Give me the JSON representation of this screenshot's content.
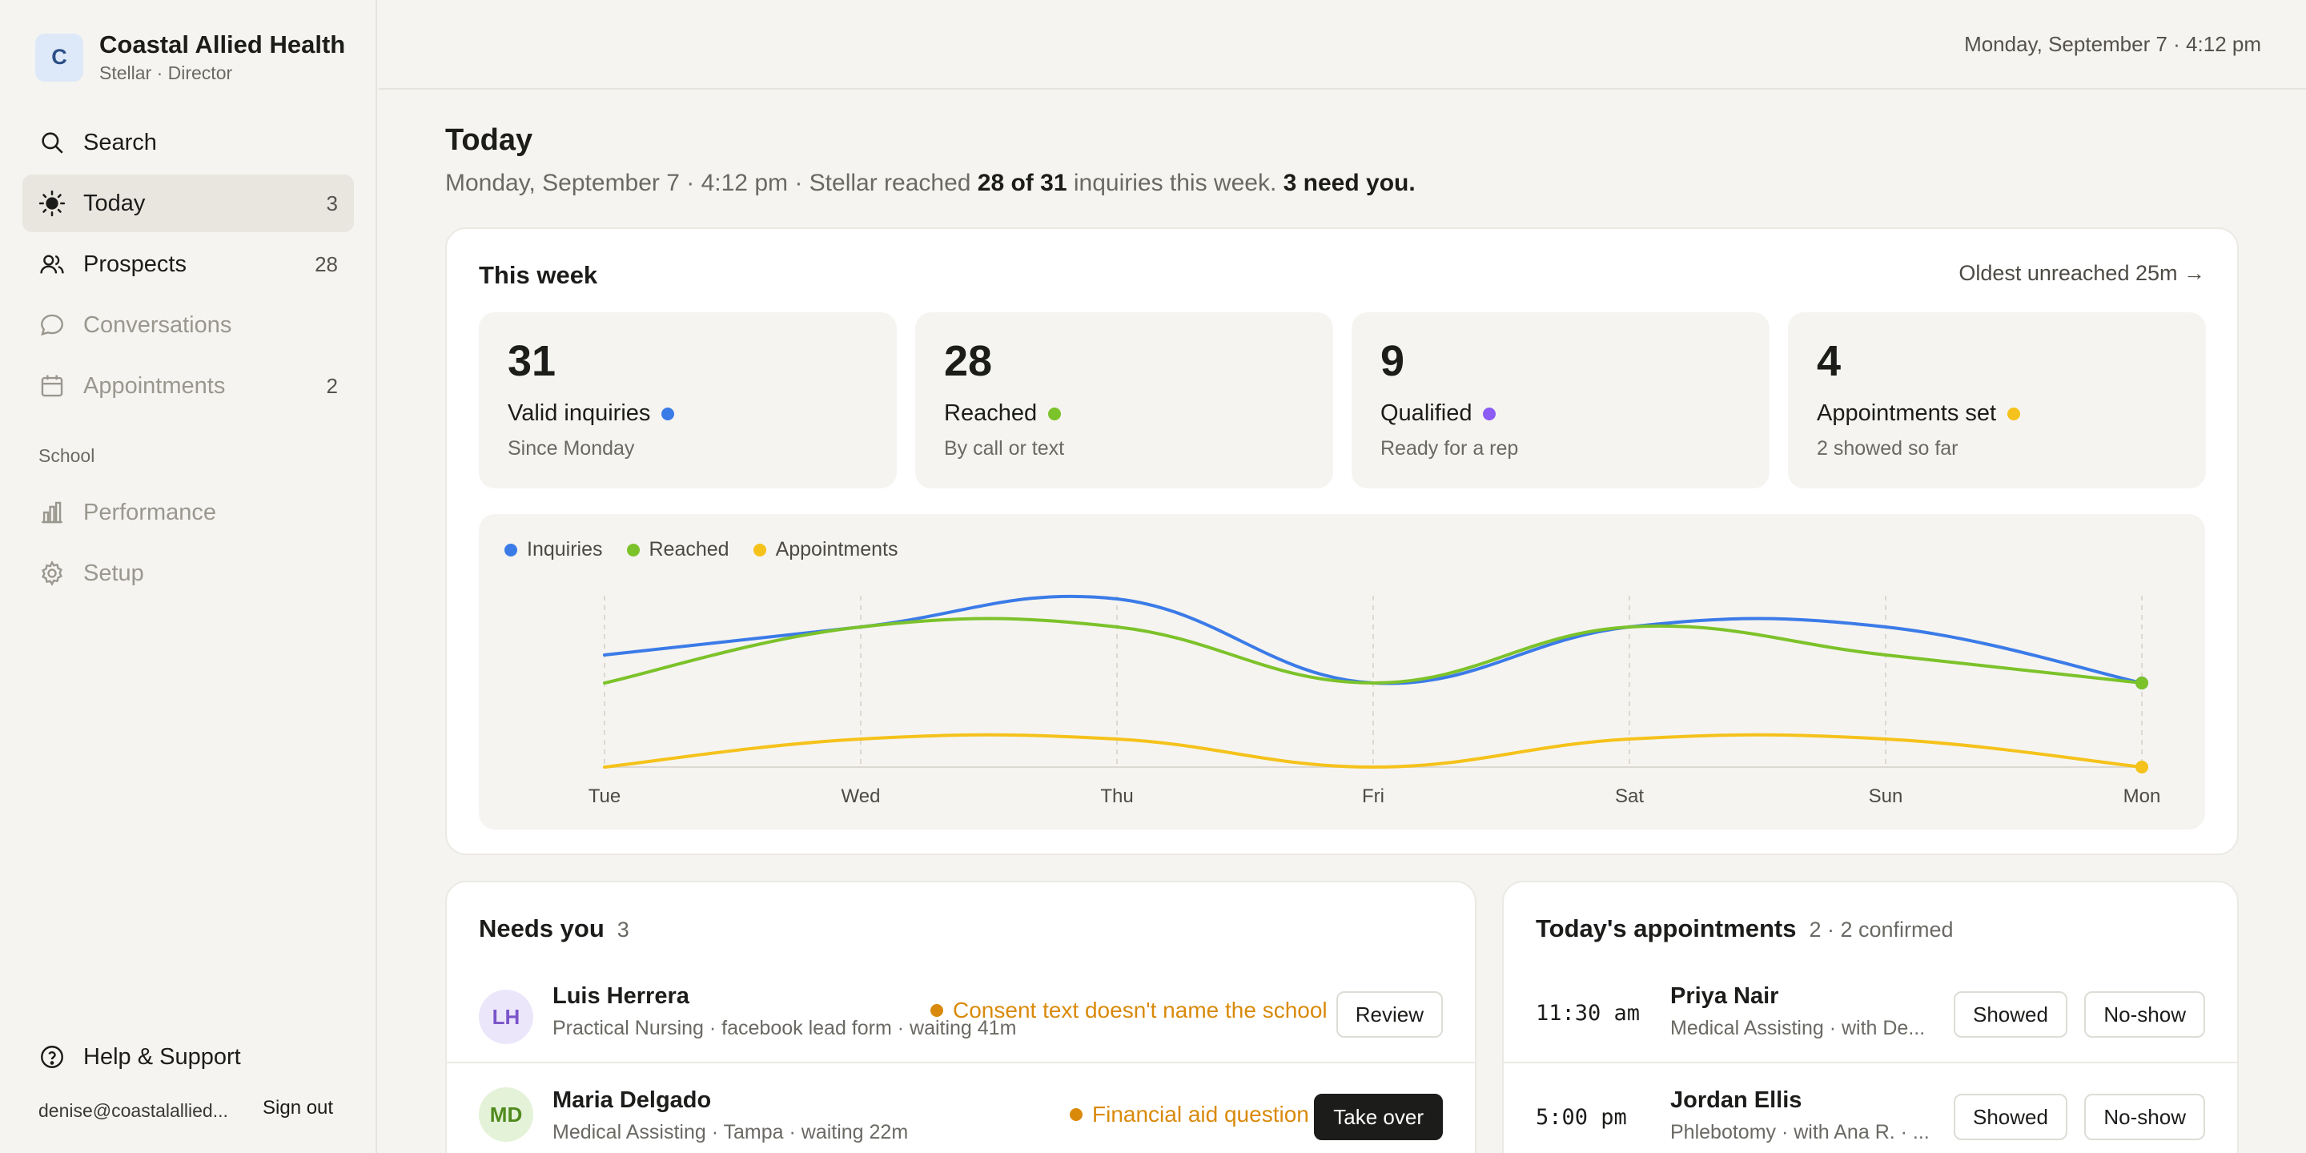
{
  "org": {
    "initial": "C",
    "name": "Coastal Allied Health",
    "sub": "Stellar · Director"
  },
  "nav": {
    "search": {
      "label": "Search"
    },
    "today": {
      "label": "Today",
      "count": "3"
    },
    "prospects": {
      "label": "Prospects",
      "count": "28"
    },
    "conversations": {
      "label": "Conversations"
    },
    "appointments": {
      "label": "Appointments",
      "count": "2"
    },
    "section": "School",
    "performance": {
      "label": "Performance"
    },
    "setup": {
      "label": "Setup"
    },
    "help": {
      "label": "Help & Support"
    }
  },
  "footer": {
    "email": "denise@coastalallied...",
    "signout": "Sign out"
  },
  "topbar": {
    "datetime": "Monday, September 7 · 4:12 pm"
  },
  "header": {
    "title": "Today",
    "sub_prefix": "Monday, September 7 · 4:12 pm · Stellar reached ",
    "sub_bold1": "28 of 31",
    "sub_mid": " inquiries this week. ",
    "sub_bold2": "3 need you."
  },
  "week": {
    "title": "This week",
    "oldest": "Oldest unreached 25m →",
    "stats": [
      {
        "value": "31",
        "label": "Valid inquiries",
        "sub": "Since Monday",
        "color": "#3b7be8"
      },
      {
        "value": "28",
        "label": "Reached",
        "sub": "By call or text",
        "color": "#7cc22a"
      },
      {
        "value": "9",
        "label": "Qualified",
        "sub": "Ready for a rep",
        "color": "#8b5cf6"
      },
      {
        "value": "4",
        "label": "Appointments set",
        "sub": "2 showed so far",
        "color": "#f5c21b"
      }
    ]
  },
  "chart_data": {
    "type": "line",
    "categories": [
      "Tue",
      "Wed",
      "Thu",
      "Fri",
      "Sat",
      "Sun",
      "Mon"
    ],
    "ylim": [
      0,
      6
    ],
    "grid": "vertical dashed",
    "legend": "top-left",
    "series": [
      {
        "name": "Inquiries",
        "color": "#3b7be8",
        "values": [
          4,
          5,
          6,
          3,
          5,
          5,
          3
        ]
      },
      {
        "name": "Reached",
        "color": "#7cc22a",
        "values": [
          3,
          5,
          5,
          3,
          5,
          4,
          3
        ]
      },
      {
        "name": "Appointments",
        "color": "#f5c21b",
        "values": [
          0,
          1,
          1,
          0,
          1,
          1,
          0
        ]
      }
    ]
  },
  "needs": {
    "title": "Needs you",
    "count": "3",
    "rows": [
      {
        "initials": "LH",
        "name": "Luis Herrera",
        "meta": "Practical Nursing · facebook lead form · waiting 41m",
        "flag": "Consent text doesn't name the school",
        "action": "Review",
        "avatar_bg": "#ece6fb",
        "avatar_fg": "#7a55c9"
      },
      {
        "initials": "MD",
        "name": "Maria Delgado",
        "meta": "Medical Assisting · Tampa · waiting 22m",
        "flag": "Financial aid question",
        "action": "Take over",
        "avatar_bg": "#e4f2d8",
        "avatar_fg": "#4f8a1e"
      }
    ]
  },
  "appts": {
    "title": "Today's appointments",
    "count": "2 · 2 confirmed",
    "rows": [
      {
        "time": "11:30 am",
        "name": "Priya Nair",
        "meta": "Medical Assisting · with De...",
        "showed": "Showed",
        "noshow": "No-show"
      },
      {
        "time": "5:00 pm",
        "name": "Jordan Ellis",
        "meta": "Phlebotomy · with Ana R. · ...",
        "showed": "Showed",
        "noshow": "No-show"
      }
    ]
  }
}
